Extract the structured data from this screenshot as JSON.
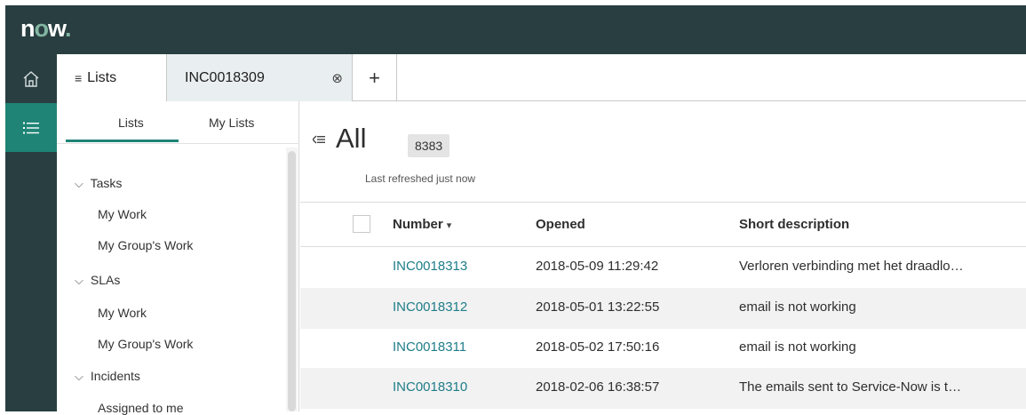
{
  "brand": {
    "logo_text_1": "n",
    "logo_text_2": "o",
    "logo_text_3": "w",
    "logo_dot": "."
  },
  "rail": {
    "icons": [
      "home-icon",
      "list-icon"
    ]
  },
  "tabs": {
    "lists_label": "Lists",
    "record_label": "INC0018309",
    "close_glyph": "⊗",
    "add_glyph": "+"
  },
  "panel": {
    "tabs": [
      "Lists",
      "My Lists"
    ],
    "tree": [
      {
        "type": "group",
        "label": "Tasks"
      },
      {
        "type": "item",
        "label": "My Work"
      },
      {
        "type": "item",
        "label": "My Group's Work"
      },
      {
        "type": "group",
        "label": "SLAs"
      },
      {
        "type": "item",
        "label": "My Work"
      },
      {
        "type": "item",
        "label": "My Group's Work"
      },
      {
        "type": "group",
        "label": "Incidents"
      },
      {
        "type": "item",
        "label": "Assigned to me"
      }
    ]
  },
  "list": {
    "title": "All",
    "count": "8383",
    "refreshed": "Last refreshed just now",
    "columns": [
      "Number",
      "Opened",
      "Short description"
    ],
    "sort_glyph": "▾",
    "rows": [
      {
        "number": "INC0018313",
        "opened": "2018-05-09 11:29:42",
        "desc": "Verloren verbinding met het draadlo…"
      },
      {
        "number": "INC0018312",
        "opened": "2018-05-01 13:22:55",
        "desc": "email is not working"
      },
      {
        "number": "INC0018311",
        "opened": "2018-05-02 17:50:16",
        "desc": "email is not working"
      },
      {
        "number": "INC0018310",
        "opened": "2018-02-06 16:38:57",
        "desc": "The emails sent to Service-Now is t…"
      }
    ]
  },
  "colors": {
    "banner": "#293e40",
    "accent": "#1f8476",
    "link": "#1e7d89",
    "logo_o": "#81b5a1"
  }
}
